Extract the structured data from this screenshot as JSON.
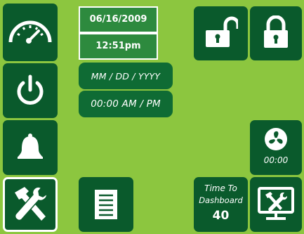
{
  "datetime": {
    "date": "06/16/2009",
    "time": "12:51pm"
  },
  "inputs": {
    "date_format_button": "MM / DD / YYYY",
    "time_format_button": "00:00 AM / PM"
  },
  "fan": {
    "timer": "00:00"
  },
  "dashboard_countdown": {
    "label_line1": "Time To",
    "label_line2": "Dashboard",
    "seconds": "40"
  },
  "icons": {
    "left_nav": [
      "gauge-icon",
      "power-icon",
      "bell-icon",
      "tools-icon"
    ],
    "document": "document-icon",
    "unlock": "unlock-icon",
    "lock": "lock-icon",
    "fan": "fan-icon",
    "settings_monitor": "monitor-tools-icon"
  },
  "colors": {
    "background": "#8cc63f",
    "tile": "#0a5a2c",
    "accent_box": "#2d8a3e"
  }
}
